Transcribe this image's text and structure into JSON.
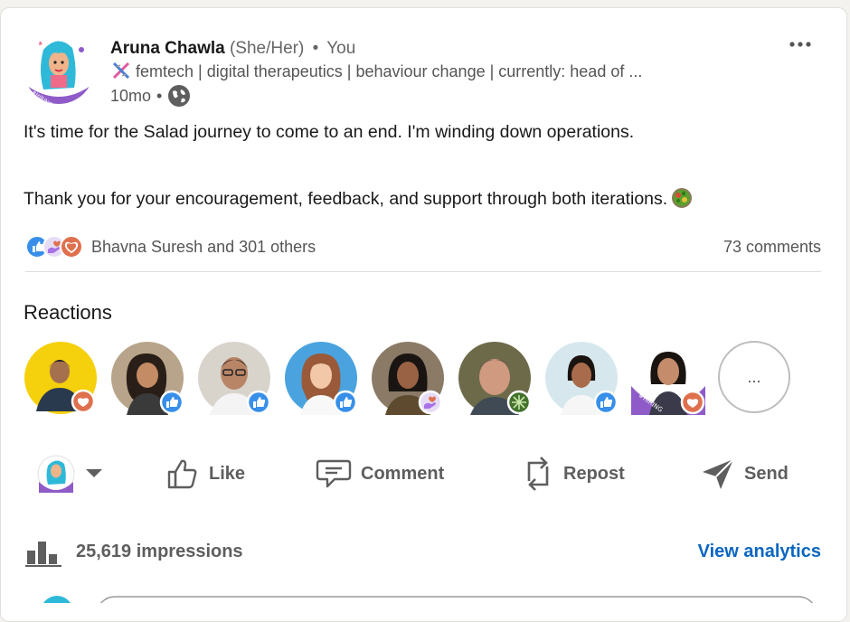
{
  "post": {
    "author": {
      "name": "Aruna Chawla",
      "pronouns": "(She/Her)",
      "separator": "•",
      "relation": "You",
      "headline": "femtech | digital therapeutics | behaviour change | currently: head of ...",
      "time": "10mo",
      "time_separator": "•",
      "avatar_badge": "#HIRING"
    },
    "text": {
      "line1": "It's time for the Salad journey to come to an end. I'm winding down operations.",
      "line2": "Thank you for your encouragement, feedback, and support through both iterations."
    },
    "social": {
      "reactors": "Bhavna Suresh and 301 others",
      "comments": "73 comments"
    },
    "reactions_title": "Reactions",
    "reactors": [
      {
        "name": "reactor-1",
        "reaction": "love",
        "bg": "#f5d00c"
      },
      {
        "name": "reactor-2",
        "reaction": "like",
        "bg": "#b8a48a"
      },
      {
        "name": "reactor-3",
        "reaction": "like",
        "bg": "#d8d4cc"
      },
      {
        "name": "reactor-4",
        "reaction": "like",
        "bg": "#4aa3df"
      },
      {
        "name": "reactor-5",
        "reaction": "support",
        "bg": "#8a7a66"
      },
      {
        "name": "reactor-6",
        "reaction": "insightful",
        "bg": "#6d6a4a"
      },
      {
        "name": "reactor-7",
        "reaction": "like",
        "bg": "#d6e8ee"
      },
      {
        "name": "reactor-8",
        "reaction": "love",
        "bg": "#8e5bc8"
      }
    ],
    "more_reactors_label": "...",
    "actions": {
      "like": "Like",
      "comment": "Comment",
      "repost": "Repost",
      "send": "Send"
    },
    "impressions": "25,619 impressions",
    "view_analytics": "View analytics",
    "colors": {
      "link_blue": "#0a66c2",
      "like_blue": "#378fe9",
      "love_red": "#df704d",
      "support_purple": "#a872e8",
      "insightful_green": "#44712e"
    }
  }
}
